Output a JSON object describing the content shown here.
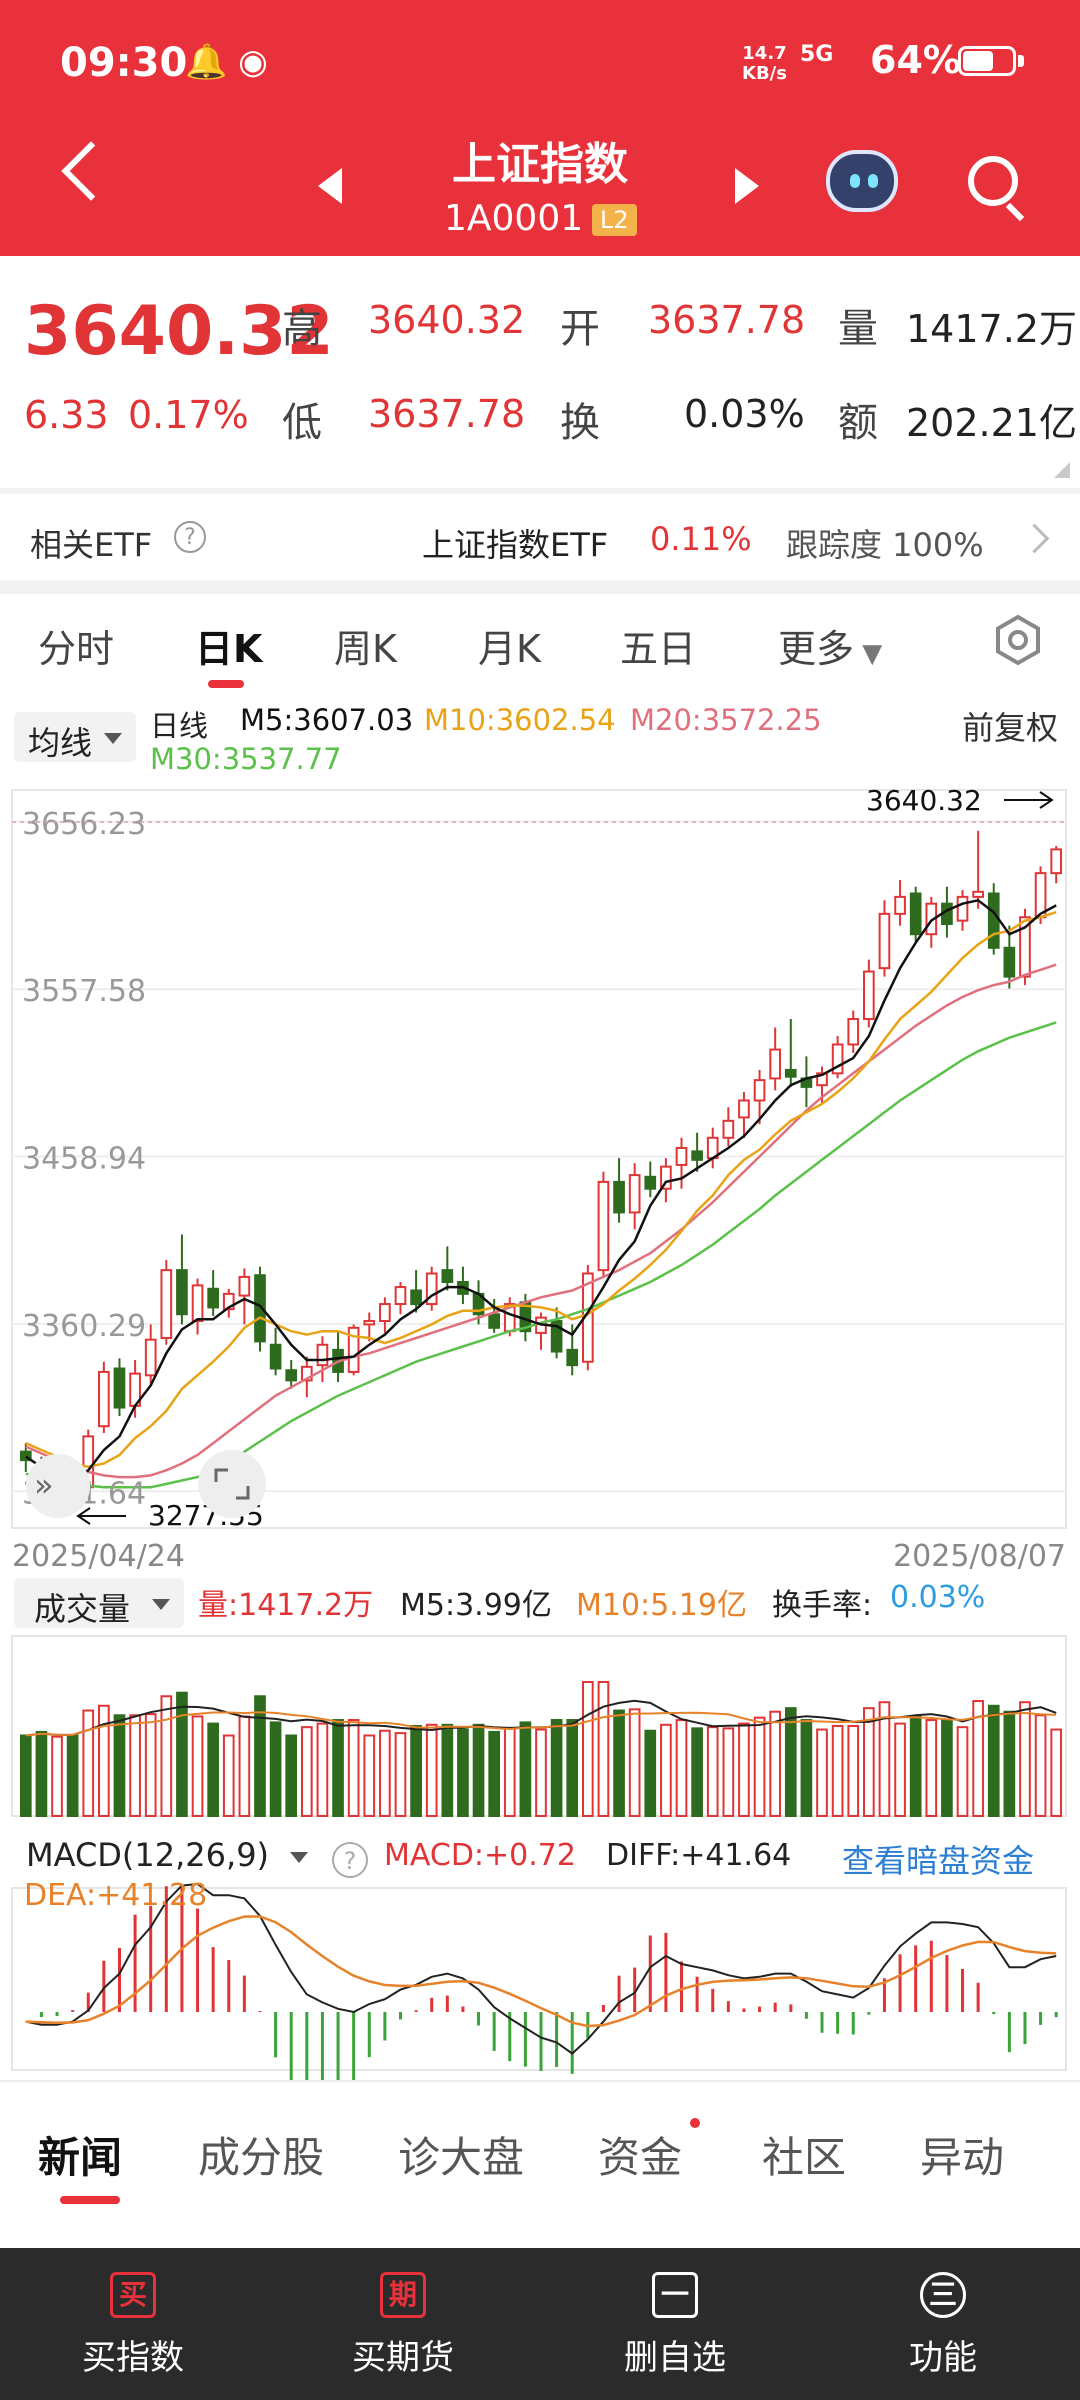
{
  "status_bar": {
    "time": "09:30",
    "app_icons": "🔔 ◉",
    "net_speed_value": "14.7",
    "net_speed_unit": "KB/s",
    "signal": "5G",
    "battery_pct": "64%",
    "battery_level": 0.64
  },
  "header": {
    "title": "上证指数",
    "code": "1A0001",
    "badge": "L2"
  },
  "quote": {
    "price": "3640.32",
    "change": "6.33",
    "change_pct": "0.17%",
    "high_label": "高",
    "high": "3640.32",
    "open_label": "开",
    "open": "3637.78",
    "vol_label": "量",
    "vol": "1417.2万",
    "low_label": "低",
    "low": "3637.78",
    "turnover_label": "换",
    "turnover": "0.03%",
    "amount_label": "额",
    "amount": "202.21亿"
  },
  "etf": {
    "label": "相关ETF",
    "help": "?",
    "name": "上证指数ETF",
    "pct": "0.11%",
    "track": "跟踪度 100%"
  },
  "tabs": [
    "分时",
    "日K",
    "周K",
    "月K",
    "五日",
    "更多"
  ],
  "ma_legend": {
    "selector": "均线",
    "type": "日线",
    "m5": "M5:3607.03",
    "m10": "M10:3602.54",
    "m20": "M20:3572.25",
    "m30": "M30:3537.77",
    "adjust": "前复权"
  },
  "colors": {
    "up": "#e03436",
    "down": "#2e6b1e",
    "m5": "#111111",
    "m10": "#e8a317",
    "m20": "#e0707d",
    "m30": "#5cc14b",
    "accent": "#e8313a",
    "link": "#2d7fd3"
  },
  "chart_data": {
    "type": "candlestick",
    "y_ticks": [
      "3656.23",
      "3557.58",
      "3458.94",
      "3360.29",
      "3261.64"
    ],
    "ylim": [
      3240,
      3675
    ],
    "last_price_label": "3640.32",
    "low_marker_label": "3277.55",
    "x_start": "2025/04/24",
    "x_end": "2025/08/07",
    "candles": [
      [
        3285,
        3290,
        3273,
        3280
      ],
      [
        3278,
        3282,
        3262,
        3268
      ],
      [
        3268,
        3276,
        3260,
        3272
      ],
      [
        3275,
        3279,
        3262,
        3266
      ],
      [
        3264,
        3298,
        3260,
        3294
      ],
      [
        3300,
        3338,
        3296,
        3332
      ],
      [
        3334,
        3340,
        3306,
        3311
      ],
      [
        3312,
        3339,
        3305,
        3331
      ],
      [
        3330,
        3360,
        3325,
        3351
      ],
      [
        3352,
        3398,
        3348,
        3392
      ],
      [
        3392,
        3413,
        3360,
        3366
      ],
      [
        3362,
        3387,
        3354,
        3383
      ],
      [
        3381,
        3392,
        3365,
        3370
      ],
      [
        3369,
        3381,
        3364,
        3378
      ],
      [
        3377,
        3393,
        3360,
        3388
      ],
      [
        3389,
        3394,
        3344,
        3350
      ],
      [
        3348,
        3358,
        3330,
        3334
      ],
      [
        3333,
        3339,
        3322,
        3327
      ],
      [
        3327,
        3341,
        3317,
        3335
      ],
      [
        3336,
        3353,
        3326,
        3348
      ],
      [
        3345,
        3356,
        3326,
        3332
      ],
      [
        3332,
        3360,
        3330,
        3358
      ],
      [
        3360,
        3367,
        3350,
        3362
      ],
      [
        3362,
        3376,
        3355,
        3372
      ],
      [
        3372,
        3385,
        3366,
        3382
      ],
      [
        3380,
        3392,
        3367,
        3372
      ],
      [
        3372,
        3394,
        3368,
        3390
      ],
      [
        3392,
        3406,
        3380,
        3385
      ],
      [
        3385,
        3394,
        3372,
        3378
      ],
      [
        3378,
        3386,
        3360,
        3366
      ],
      [
        3366,
        3375,
        3355,
        3358
      ],
      [
        3356,
        3376,
        3353,
        3372
      ],
      [
        3373,
        3378,
        3350,
        3356
      ],
      [
        3355,
        3367,
        3345,
        3364
      ],
      [
        3362,
        3370,
        3340,
        3344
      ],
      [
        3345,
        3360,
        3330,
        3336
      ],
      [
        3338,
        3395,
        3333,
        3390
      ],
      [
        3392,
        3450,
        3388,
        3444
      ],
      [
        3444,
        3458,
        3420,
        3426
      ],
      [
        3426,
        3455,
        3416,
        3448
      ],
      [
        3447,
        3456,
        3435,
        3440
      ],
      [
        3440,
        3458,
        3432,
        3453
      ],
      [
        3454,
        3470,
        3440,
        3464
      ],
      [
        3462,
        3473,
        3450,
        3457
      ],
      [
        3458,
        3476,
        3452,
        3470
      ],
      [
        3470,
        3488,
        3465,
        3480
      ],
      [
        3482,
        3497,
        3470,
        3492
      ],
      [
        3492,
        3510,
        3478,
        3504
      ],
      [
        3505,
        3535,
        3498,
        3522
      ],
      [
        3510,
        3540,
        3500,
        3506
      ],
      [
        3505,
        3518,
        3488,
        3500
      ],
      [
        3501,
        3512,
        3490,
        3508
      ],
      [
        3508,
        3530,
        3505,
        3525
      ],
      [
        3525,
        3545,
        3520,
        3540
      ],
      [
        3540,
        3575,
        3535,
        3568
      ],
      [
        3570,
        3610,
        3565,
        3602
      ],
      [
        3602,
        3622,
        3595,
        3612
      ],
      [
        3614,
        3618,
        3585,
        3590
      ],
      [
        3590,
        3612,
        3582,
        3608
      ],
      [
        3608,
        3618,
        3588,
        3596
      ],
      [
        3598,
        3616,
        3592,
        3612
      ],
      [
        3612,
        3651,
        3605,
        3615
      ],
      [
        3614,
        3620,
        3578,
        3582
      ],
      [
        3582,
        3595,
        3558,
        3565
      ],
      [
        3565,
        3605,
        3560,
        3600
      ],
      [
        3600,
        3630,
        3596,
        3626
      ],
      [
        3626,
        3642,
        3620,
        3640
      ]
    ],
    "ma5": [
      3282,
      3276,
      3272,
      3270,
      3274,
      3286,
      3294,
      3312,
      3324,
      3343,
      3357,
      3363,
      3363,
      3370,
      3375,
      3371,
      3360,
      3348,
      3339,
      3339,
      3340,
      3341,
      3348,
      3354,
      3363,
      3369,
      3377,
      3382,
      3382,
      3378,
      3370,
      3366,
      3363,
      3360,
      3359,
      3354,
      3367,
      3382,
      3398,
      3409,
      3430,
      3444,
      3446,
      3452,
      3458,
      3464,
      3471,
      3481,
      3492,
      3501,
      3505,
      3507,
      3512,
      3517,
      3530,
      3551,
      3570,
      3585,
      3598,
      3604,
      3608,
      3610,
      3603,
      3590,
      3594,
      3602,
      3607
    ],
    "ma10": [
      3290,
      3286,
      3282,
      3278,
      3276,
      3278,
      3283,
      3293,
      3300,
      3309,
      3322,
      3330,
      3338,
      3347,
      3358,
      3364,
      3360,
      3356,
      3354,
      3356,
      3356,
      3353,
      3352,
      3349,
      3352,
      3356,
      3360,
      3365,
      3368,
      3368,
      3370,
      3371,
      3371,
      3370,
      3368,
      3363,
      3366,
      3372,
      3380,
      3387,
      3395,
      3404,
      3415,
      3427,
      3436,
      3448,
      3457,
      3463,
      3472,
      3480,
      3485,
      3490,
      3497,
      3505,
      3515,
      3528,
      3540,
      3548,
      3556,
      3566,
      3576,
      3584,
      3590,
      3592,
      3598,
      3600,
      3603
    ],
    "ma20": [
      3288,
      3284,
      3280,
      3276,
      3273,
      3271,
      3270,
      3270,
      3271,
      3274,
      3278,
      3283,
      3290,
      3297,
      3304,
      3311,
      3318,
      3323,
      3328,
      3333,
      3338,
      3341,
      3343,
      3346,
      3349,
      3352,
      3355,
      3358,
      3361,
      3364,
      3367,
      3370,
      3373,
      3376,
      3378,
      3380,
      3384,
      3388,
      3392,
      3397,
      3402,
      3409,
      3416,
      3424,
      3432,
      3441,
      3450,
      3459,
      3468,
      3477,
      3486,
      3494,
      3501,
      3508,
      3515,
      3522,
      3529,
      3536,
      3542,
      3548,
      3553,
      3557,
      3560,
      3562,
      3566,
      3569,
      3572
    ],
    "ma30": [
      3272,
      3270,
      3268,
      3266,
      3265,
      3264,
      3264,
      3264,
      3264,
      3266,
      3268,
      3270,
      3274,
      3279,
      3285,
      3291,
      3297,
      3303,
      3308,
      3313,
      3318,
      3322,
      3326,
      3330,
      3334,
      3338,
      3341,
      3344,
      3347,
      3350,
      3353,
      3356,
      3358,
      3361,
      3363,
      3366,
      3369,
      3373,
      3377,
      3381,
      3385,
      3390,
      3395,
      3401,
      3407,
      3414,
      3421,
      3428,
      3436,
      3443,
      3450,
      3457,
      3464,
      3471,
      3478,
      3485,
      3492,
      3498,
      3504,
      3510,
      3516,
      3521,
      3525,
      3529,
      3532,
      3535,
      3538
    ]
  },
  "volume_legend": {
    "selector": "成交量",
    "vol": "量:1417.2万",
    "m5": "M5:3.99亿",
    "m10": "M10:5.19亿",
    "turnover_label": "换手率:",
    "turnover": "0.03%"
  },
  "macd_legend": {
    "selector": "MACD(12,26,9)",
    "help": "?",
    "macd": "MACD:+0.72",
    "diff": "DIFF:+41.64",
    "dea": "DEA:+41.28",
    "link": "查看暗盘资金"
  },
  "news_tabs": [
    "新闻",
    "成分股",
    "诊大盘",
    "资金",
    "社区",
    "异动"
  ],
  "bottom_nav": [
    {
      "icon": "买",
      "label": "买指数"
    },
    {
      "icon": "期",
      "label": "买期货"
    },
    {
      "icon": "一",
      "label": "删自选"
    },
    {
      "icon": "三",
      "label": "功能"
    }
  ]
}
